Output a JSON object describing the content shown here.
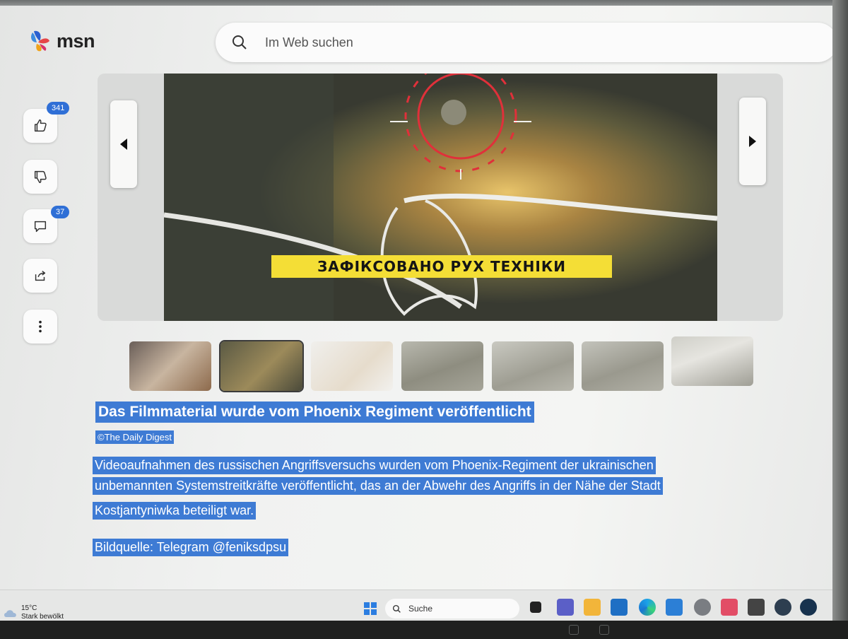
{
  "header": {
    "brand": "msn",
    "search_placeholder": "Im Web suchen"
  },
  "actions": {
    "likes_count": "341",
    "comments_count": "37"
  },
  "media": {
    "video_caption": "ЗАФІКСОВАНО РУХ ТЕХНІКИ",
    "thumbnail_count": 7
  },
  "article": {
    "headline": "Das Filmmaterial wurde vom Phoenix Regiment veröffentlicht",
    "source": "©The Daily Digest",
    "body_lines": [
      "Videoaufnahmen des russischen Angriffsversuchs wurden vom Phoenix-Regiment der ukrainischen",
      "unbemannten Systemstreitkräfte veröffentlicht, das an der Abwehr des Angriffs in der Nähe der Stadt",
      "Kostjantyniwka beteiligt war."
    ],
    "image_credit": "Bildquelle: Telegram @feniksdpsu"
  },
  "taskbar": {
    "temperature": "15°C",
    "weather_text": "Stark bewölkt",
    "search_label": "Suche"
  },
  "colors": {
    "selection": "#3e7bd4",
    "badge": "#2f6fd6",
    "caption_band": "#f4de36",
    "target_ring": "#e0303a"
  }
}
